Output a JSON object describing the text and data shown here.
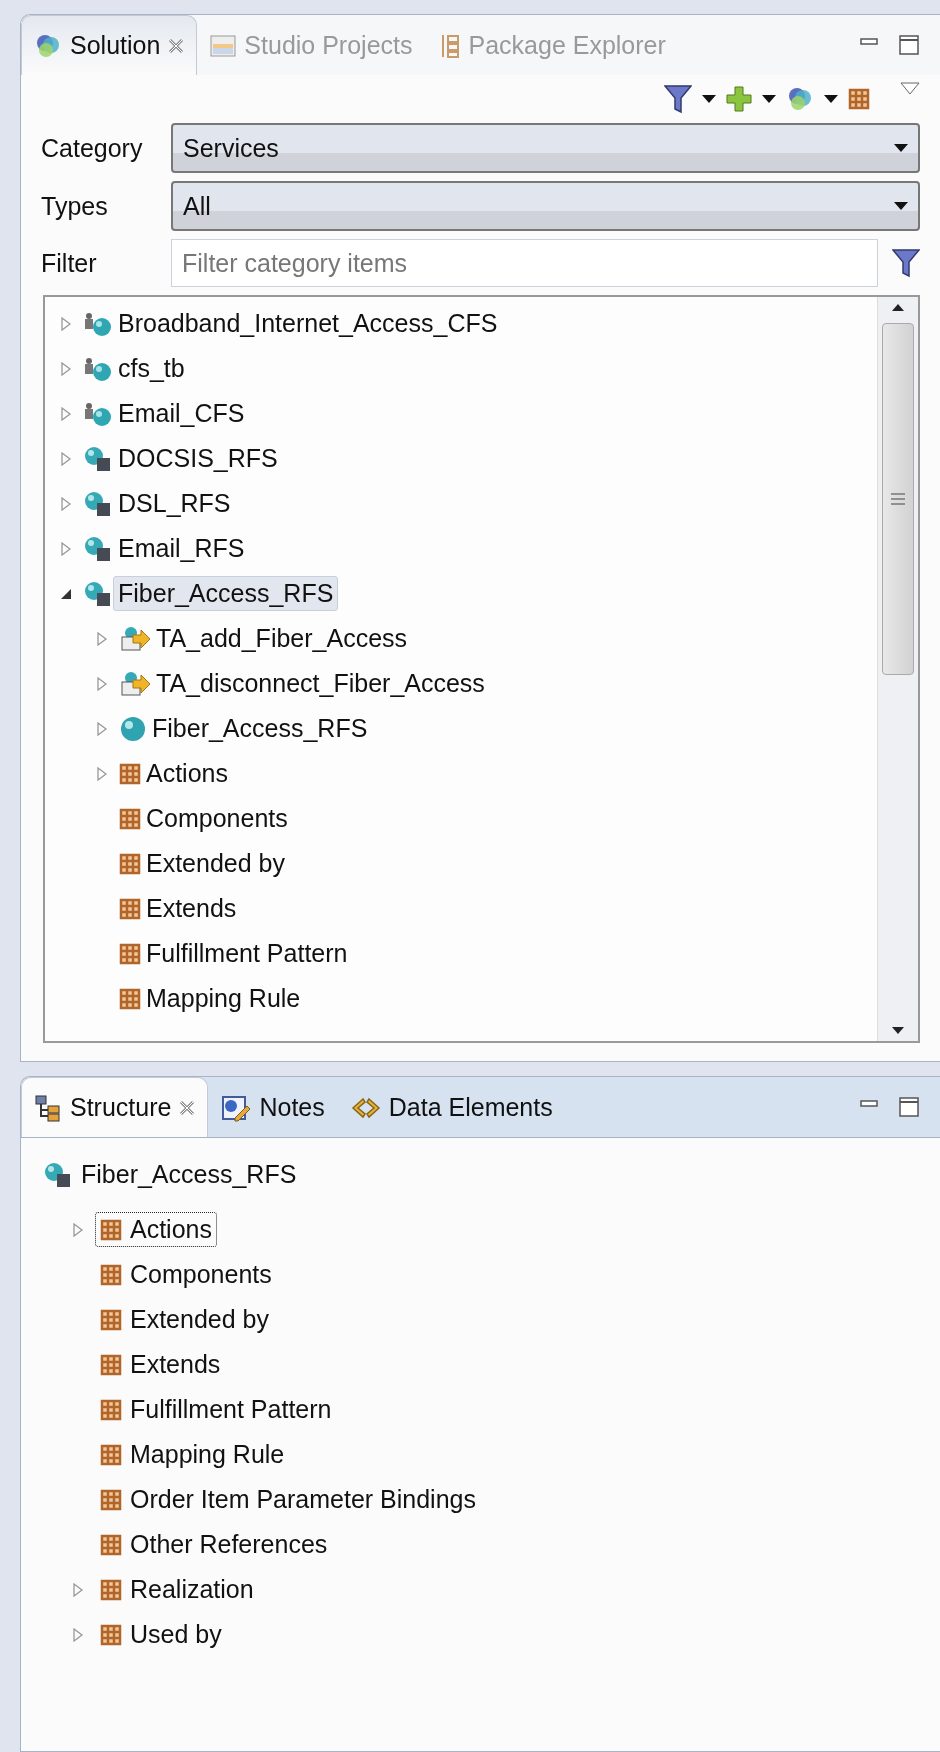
{
  "solution_view": {
    "tabs": [
      {
        "label": "Solution",
        "kind": "solution",
        "selected": true,
        "closable": true
      },
      {
        "label": "Studio Projects",
        "kind": "projects",
        "selected": false,
        "closable": false
      },
      {
        "label": "Package Explorer",
        "kind": "packages",
        "selected": false,
        "closable": false
      }
    ],
    "category": {
      "label": "Category",
      "value": "Services"
    },
    "types": {
      "label": "Types",
      "value": "All"
    },
    "filter": {
      "label": "Filter",
      "placeholder": "Filter category items"
    },
    "tree": [
      {
        "label": "Broadband_Internet_Access_CFS",
        "kind": "cfs",
        "expandable": true,
        "expanded": false,
        "selected": false
      },
      {
        "label": "cfs_tb",
        "kind": "cfs",
        "expandable": true,
        "expanded": false,
        "selected": false
      },
      {
        "label": "Email_CFS",
        "kind": "cfs",
        "expandable": true,
        "expanded": false,
        "selected": false
      },
      {
        "label": "DOCSIS_RFS",
        "kind": "rfs",
        "expandable": true,
        "expanded": false,
        "selected": false
      },
      {
        "label": "DSL_RFS",
        "kind": "rfs",
        "expandable": true,
        "expanded": false,
        "selected": false
      },
      {
        "label": "Email_RFS",
        "kind": "rfs",
        "expandable": true,
        "expanded": false,
        "selected": false
      },
      {
        "label": "Fiber_Access_RFS",
        "kind": "rfs",
        "expandable": true,
        "expanded": true,
        "selected": true,
        "children": [
          {
            "label": "TA_add_Fiber_Access",
            "kind": "action",
            "expandable": true,
            "expanded": false,
            "selected": false
          },
          {
            "label": "TA_disconnect_Fiber_Access",
            "kind": "action",
            "expandable": true,
            "expanded": false,
            "selected": false
          },
          {
            "label": "Fiber_Access_RFS",
            "kind": "sphere",
            "expandable": true,
            "expanded": false,
            "selected": false
          },
          {
            "label": "Actions",
            "kind": "folder",
            "expandable": true,
            "expanded": false,
            "selected": false
          },
          {
            "label": "Components",
            "kind": "folder",
            "expandable": false,
            "expanded": false,
            "selected": false
          },
          {
            "label": "Extended by",
            "kind": "folder",
            "expandable": false,
            "expanded": false,
            "selected": false
          },
          {
            "label": "Extends",
            "kind": "folder",
            "expandable": false,
            "expanded": false,
            "selected": false
          },
          {
            "label": "Fulfillment Pattern",
            "kind": "folder",
            "expandable": false,
            "expanded": false,
            "selected": false
          },
          {
            "label": "Mapping Rule",
            "kind": "folder",
            "expandable": false,
            "expanded": false,
            "selected": false
          }
        ]
      }
    ]
  },
  "structure_view": {
    "tabs": [
      {
        "label": "Structure",
        "kind": "structure",
        "selected": true,
        "closable": true
      },
      {
        "label": "Notes",
        "kind": "notes",
        "selected": false,
        "closable": false
      },
      {
        "label": "Data Elements",
        "kind": "data",
        "selected": false,
        "closable": false
      }
    ],
    "root": {
      "label": "Fiber_Access_RFS",
      "kind": "rfs"
    },
    "items": [
      {
        "label": "Actions",
        "kind": "folder",
        "expandable": true,
        "focused": true
      },
      {
        "label": "Components",
        "kind": "folder",
        "expandable": false,
        "focused": false
      },
      {
        "label": "Extended by",
        "kind": "folder",
        "expandable": false,
        "focused": false
      },
      {
        "label": "Extends",
        "kind": "folder",
        "expandable": false,
        "focused": false
      },
      {
        "label": "Fulfillment Pattern",
        "kind": "folder",
        "expandable": false,
        "focused": false
      },
      {
        "label": "Mapping Rule",
        "kind": "folder",
        "expandable": false,
        "focused": false
      },
      {
        "label": "Order Item Parameter Bindings",
        "kind": "folder",
        "expandable": false,
        "focused": false
      },
      {
        "label": "Other References",
        "kind": "folder",
        "expandable": false,
        "focused": false
      },
      {
        "label": "Realization",
        "kind": "folder",
        "expandable": true,
        "focused": false
      },
      {
        "label": "Used by",
        "kind": "folder",
        "expandable": true,
        "focused": false
      }
    ]
  }
}
